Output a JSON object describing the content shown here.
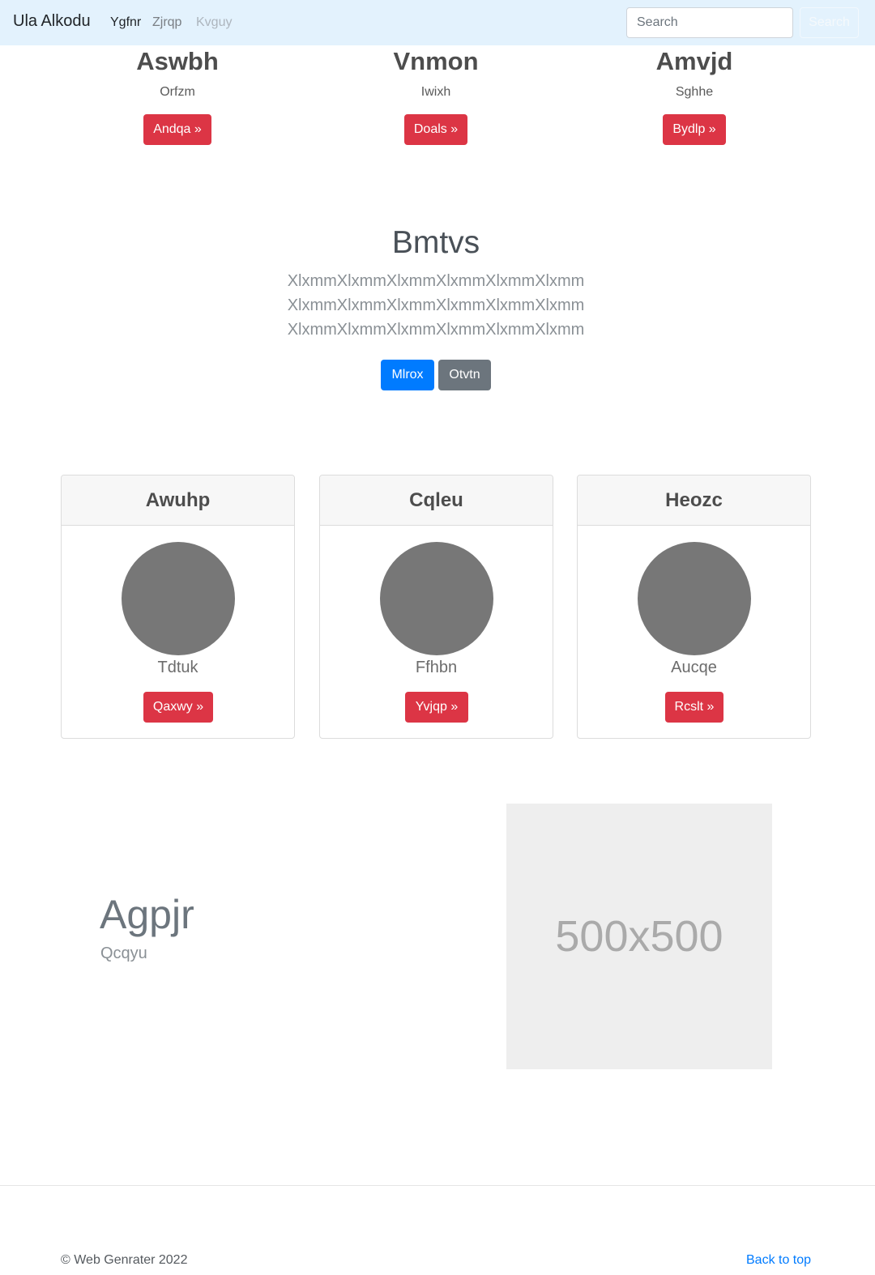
{
  "navbar": {
    "brand": "Ula Alkodu",
    "links": [
      {
        "label": "Ygfnr",
        "state": "active"
      },
      {
        "label": "Zjrqp",
        "state": "normal"
      },
      {
        "label": "Kvguy",
        "state": "disabled"
      }
    ],
    "search_placeholder": "Search",
    "search_button": "Search"
  },
  "columns": [
    {
      "heading": "Aswbh",
      "subtitle": "Orfzm",
      "button": "Andqa »"
    },
    {
      "heading": "Vnmon",
      "subtitle": "Iwixh",
      "button": "Doals »"
    },
    {
      "heading": "Amvjd",
      "subtitle": "Sghhe",
      "button": "Bydlp »"
    }
  ],
  "jumbotron": {
    "title": "Bmtvs",
    "lead_lines": [
      "XlxmmXlxmmXlxmmXlxmmXlxmmXlxmm",
      "XlxmmXlxmmXlxmmXlxmmXlxmmXlxmm",
      "XlxmmXlxmmXlxmmXlxmmXlxmmXlxmm"
    ],
    "primary_button": "Mlrox",
    "secondary_button": "Otvtn"
  },
  "cards": [
    {
      "header": "Awuhp",
      "name": "Tdtuk",
      "button": "Qaxwy »"
    },
    {
      "header": "Cqleu",
      "name": "Ffhbn",
      "button": "Yvjqp »"
    },
    {
      "header": "Heozc",
      "name": "Aucqe",
      "button": "Rcslt »"
    }
  ],
  "feature": {
    "title": "Agpjr",
    "subtitle": "Qcqyu",
    "image_label": "500x500"
  },
  "footer": {
    "copyright": "© Web Genrater 2022",
    "back_to_top": "Back to top"
  },
  "colors": {
    "navbar_bg": "#e3f2fd",
    "danger": "#dc3545",
    "primary": "#007bff",
    "secondary": "#6c757d"
  }
}
